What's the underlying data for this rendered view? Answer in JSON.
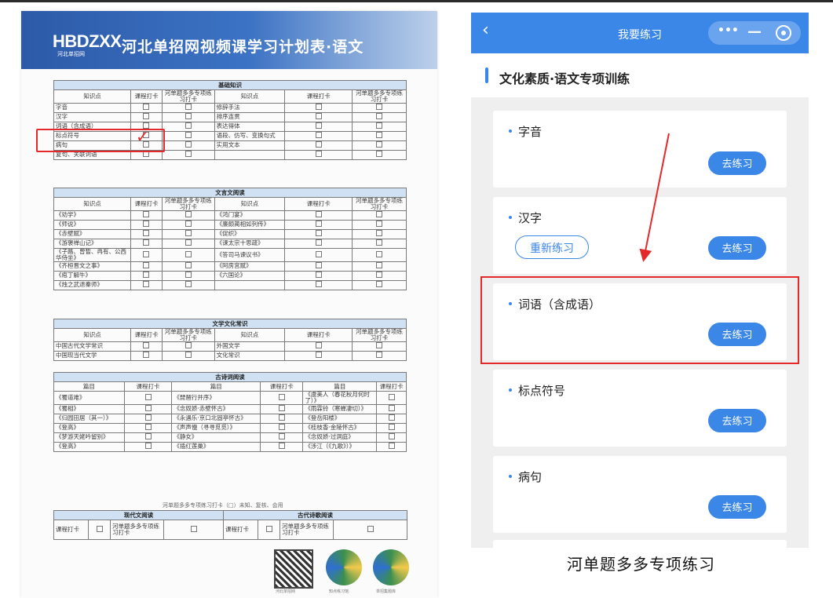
{
  "paper": {
    "logo": "HBDZXX",
    "logo_sub": "河北单招网",
    "title": "河北单招网视频课学习计划表·语文",
    "footer_note": "河单题多多专项练习打卡（□）未知、复核、会用",
    "qr_captions": [
      "河北单招网",
      "知点练习馆",
      "单招集题库"
    ],
    "sections": [
      {
        "title": "基础知识",
        "kind": "double",
        "headers": [
          "知识点",
          "课程打卡",
          "河单题多多专项练习打卡",
          "知识点",
          "课程打卡",
          "河单题多多专项练习打卡"
        ],
        "rows": [
          [
            "字音",
            "",
            "",
            "修辞手法",
            "",
            ""
          ],
          [
            "汉字",
            "",
            "",
            "排序连贯",
            "",
            ""
          ],
          [
            "词语（含成语）",
            "",
            "",
            "表达得体",
            "",
            ""
          ],
          [
            "标点符号",
            "",
            "",
            "语段、仿写、变换句式",
            "",
            ""
          ],
          [
            "病句",
            "",
            "",
            "实用文本",
            "",
            ""
          ],
          [
            "复句、关联词语",
            "",
            "",
            "",
            "",
            ""
          ]
        ]
      },
      {
        "title": "文言文阅读",
        "kind": "double",
        "headers": [
          "知识点",
          "课程打卡",
          "河单题多多专项练习打卡",
          "知识点",
          "课程打卡",
          "河单题多多专项练习打卡"
        ],
        "rows": [
          [
            "《劝学》",
            "",
            "",
            "《鸿门宴》",
            "",
            ""
          ],
          [
            "《师说》",
            "",
            "",
            "《廉颇蔺相如列传》",
            "",
            ""
          ],
          [
            "《赤壁赋》",
            "",
            "",
            "《促织》",
            "",
            ""
          ],
          [
            "《游褒禅山记》",
            "",
            "",
            "《谏太宗十思疏》",
            "",
            ""
          ],
          [
            "《子路、曾皙、冉有、公西华侍坐》",
            "",
            "",
            "《答司马谏议书》",
            "",
            ""
          ],
          [
            "《齐桓晋文之事》",
            "",
            "",
            "《阿房宫赋》",
            "",
            ""
          ],
          [
            "《庖丁解牛》",
            "",
            "",
            "《六国论》",
            "",
            ""
          ],
          [
            "《烛之武退秦师》",
            "",
            "",
            "",
            "",
            ""
          ]
        ]
      },
      {
        "title": "文学文化常识",
        "kind": "double",
        "headers": [
          "知识点",
          "课程打卡",
          "河单题多多专项练习打卡",
          "知识点",
          "课程打卡",
          "河单题多多专项练习打卡"
        ],
        "rows": [
          [
            "中国古代文学常识",
            "",
            "",
            "外国文学",
            "",
            ""
          ],
          [
            "中国现当代文学",
            "",
            "",
            "文化常识",
            "",
            ""
          ]
        ]
      },
      {
        "title": "古诗词阅读",
        "kind": "triple",
        "headers": [
          "篇目",
          "课程打卡",
          "篇目",
          "课程打卡",
          "篇目",
          "课程打卡"
        ],
        "rows": [
          [
            "《蜀道难》",
            "",
            "《琵琶行并序》",
            "",
            "《虞美人（春花秋月何时了）》",
            ""
          ],
          [
            "《蜀相》",
            "",
            "《念奴娇·赤壁怀古》",
            "",
            "《雨霖铃（寒蝉凄切）》",
            ""
          ],
          [
            "《归园田居（其一）》",
            "",
            "《永遇乐·京口北固亭怀古》",
            "",
            "《登岳阳楼》",
            ""
          ],
          [
            "《登高》",
            "",
            "《声声慢（寻寻觅觅）》",
            "",
            "《桂枝香·金陵怀古》",
            ""
          ],
          [
            "《梦游天姥吟留别》",
            "",
            "《静女》",
            "",
            "《念奴娇·过洞庭》",
            ""
          ],
          [
            "《登高》",
            "",
            "《插红莲巢》",
            "",
            "《涉江（《九歌》）》",
            ""
          ]
        ]
      }
    ],
    "bottom": {
      "left_title": "现代文阅读",
      "right_title": "古代诗歌阅读",
      "left_cells": [
        "课程打卡",
        "河单题多多专项练习打卡"
      ],
      "right_cells": [
        "课程打卡",
        "河单题多多专项练习打卡"
      ]
    }
  },
  "phone": {
    "back_icon": "chevron-left-icon",
    "title": "我要练习",
    "section_title": "文化素质·语文专项训练",
    "cards": [
      {
        "title": "字音",
        "action": "去练习"
      },
      {
        "title": "汉字",
        "action": "去练习",
        "secondary": "重新练习"
      },
      {
        "title": "词语（含成语）",
        "action": "去练习",
        "highlight": true
      },
      {
        "title": "标点符号",
        "action": "去练习"
      },
      {
        "title": "病句",
        "action": "去练习"
      }
    ]
  },
  "caption": "河单题多多专项练习",
  "colors": {
    "accent": "#3b87e8",
    "highlight": "#e32929",
    "banner": "#2c5aa8"
  }
}
